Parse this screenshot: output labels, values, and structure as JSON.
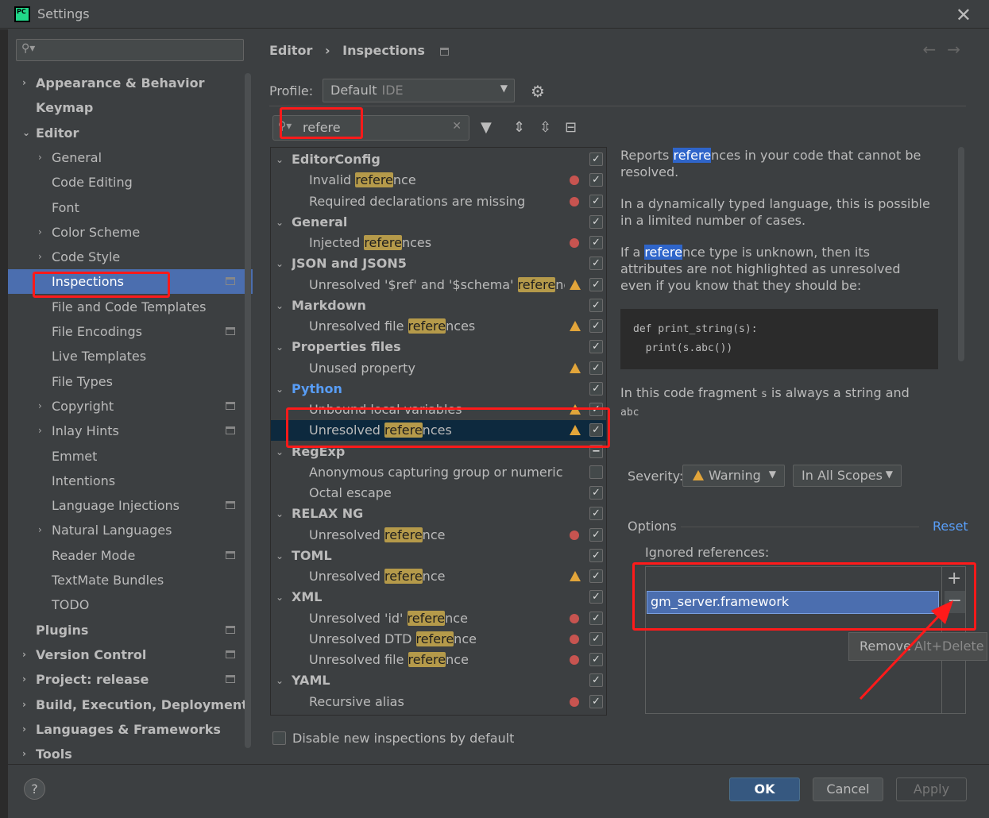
{
  "window": {
    "title": "Settings",
    "app_icon_text": "PC"
  },
  "sidebar": {
    "search_placeholder": "",
    "items": [
      {
        "label": "Appearance & Behavior",
        "bold": true,
        "chevron": "›",
        "indent": 0
      },
      {
        "label": "Keymap",
        "bold": true,
        "chevron": "",
        "indent": 0
      },
      {
        "label": "Editor",
        "bold": true,
        "chevron": "⌄",
        "indent": 0
      },
      {
        "label": "General",
        "chevron": "›",
        "indent": 1
      },
      {
        "label": "Code Editing",
        "chevron": "",
        "indent": 1
      },
      {
        "label": "Font",
        "chevron": "",
        "indent": 1
      },
      {
        "label": "Color Scheme",
        "chevron": "›",
        "indent": 1
      },
      {
        "label": "Code Style",
        "chevron": "›",
        "indent": 1
      },
      {
        "label": "Inspections",
        "chevron": "",
        "indent": 1,
        "selected": true,
        "proj": true
      },
      {
        "label": "File and Code Templates",
        "chevron": "",
        "indent": 1
      },
      {
        "label": "File Encodings",
        "chevron": "",
        "indent": 1,
        "proj": true
      },
      {
        "label": "Live Templates",
        "chevron": "",
        "indent": 1
      },
      {
        "label": "File Types",
        "chevron": "",
        "indent": 1
      },
      {
        "label": "Copyright",
        "chevron": "›",
        "indent": 1,
        "proj": true
      },
      {
        "label": "Inlay Hints",
        "chevron": "›",
        "indent": 1,
        "proj": true
      },
      {
        "label": "Emmet",
        "chevron": "",
        "indent": 1
      },
      {
        "label": "Intentions",
        "chevron": "",
        "indent": 1
      },
      {
        "label": "Language Injections",
        "chevron": "",
        "indent": 1,
        "proj": true
      },
      {
        "label": "Natural Languages",
        "chevron": "›",
        "indent": 1
      },
      {
        "label": "Reader Mode",
        "chevron": "",
        "indent": 1,
        "proj": true
      },
      {
        "label": "TextMate Bundles",
        "chevron": "",
        "indent": 1
      },
      {
        "label": "TODO",
        "chevron": "",
        "indent": 1
      },
      {
        "label": "Plugins",
        "bold": true,
        "chevron": "",
        "indent": 0,
        "proj": true
      },
      {
        "label": "Version Control",
        "bold": true,
        "chevron": "›",
        "indent": 0,
        "proj": true
      },
      {
        "label": "Project: release",
        "bold": true,
        "chevron": "›",
        "indent": 0,
        "proj": true
      },
      {
        "label": "Build, Execution, Deployment",
        "bold": true,
        "chevron": "›",
        "indent": 0
      },
      {
        "label": "Languages & Frameworks",
        "bold": true,
        "chevron": "›",
        "indent": 0
      },
      {
        "label": "Tools",
        "bold": true,
        "chevron": "›",
        "indent": 0
      }
    ]
  },
  "breadcrumb": {
    "parent": "Editor",
    "separator": "›",
    "current": "Inspections"
  },
  "profile": {
    "label": "Profile:",
    "value": "Default",
    "scope": "IDE"
  },
  "filter": {
    "value": "refere"
  },
  "tree": [
    {
      "type": "group",
      "label": "EditorConfig",
      "check": "on"
    },
    {
      "type": "item",
      "pre": "Invalid ",
      "hl": "refere",
      "post": "nce",
      "sev": "err",
      "check": "on"
    },
    {
      "type": "item",
      "pre": "Required declarations are missing",
      "hl": "",
      "post": "",
      "sev": "err",
      "check": "on"
    },
    {
      "type": "group",
      "label": "General",
      "check": "on"
    },
    {
      "type": "item",
      "pre": "Injected ",
      "hl": "refere",
      "post": "nces",
      "sev": "err",
      "check": "on"
    },
    {
      "type": "group",
      "label": "JSON and JSON5",
      "check": "on"
    },
    {
      "type": "item",
      "pre": "Unresolved '$ref' and '$schema' ",
      "hl": "refere",
      "post": "nces",
      "sev": "warn",
      "check": "on"
    },
    {
      "type": "group",
      "label": "Markdown",
      "check": "on"
    },
    {
      "type": "item",
      "pre": "Unresolved file ",
      "hl": "refere",
      "post": "nces",
      "sev": "warn",
      "check": "on"
    },
    {
      "type": "group",
      "label": "Properties files",
      "check": "on"
    },
    {
      "type": "item",
      "pre": "Unused property",
      "hl": "",
      "post": "",
      "sev": "warn",
      "check": "on"
    },
    {
      "type": "group",
      "label": "Python",
      "check": "on",
      "python": true
    },
    {
      "type": "item",
      "pre": "Unbound local variables",
      "hl": "",
      "post": "",
      "sev": "warn",
      "check": "on"
    },
    {
      "type": "item",
      "pre": "Unresolved ",
      "hl": "refere",
      "post": "nces",
      "sev": "warn",
      "check": "on",
      "selected": true
    },
    {
      "type": "group",
      "label": "RegExp",
      "check": "mixed"
    },
    {
      "type": "item",
      "pre": "Anonymous capturing group or numeric bac",
      "hl": "",
      "post": "",
      "sev": "",
      "check": "off"
    },
    {
      "type": "item",
      "pre": "Octal escape",
      "hl": "",
      "post": "",
      "sev": "",
      "check": "on"
    },
    {
      "type": "group",
      "label": "RELAX NG",
      "check": "on"
    },
    {
      "type": "item",
      "pre": "Unresolved ",
      "hl": "refere",
      "post": "nce",
      "sev": "err",
      "check": "on"
    },
    {
      "type": "group",
      "label": "TOML",
      "check": "on"
    },
    {
      "type": "item",
      "pre": "Unresolved ",
      "hl": "refere",
      "post": "nce",
      "sev": "warn",
      "check": "on"
    },
    {
      "type": "group",
      "label": "XML",
      "check": "on"
    },
    {
      "type": "item",
      "pre": "Unresolved 'id' ",
      "hl": "refere",
      "post": "nce",
      "sev": "err",
      "check": "on"
    },
    {
      "type": "item",
      "pre": "Unresolved DTD ",
      "hl": "refere",
      "post": "nce",
      "sev": "err",
      "check": "on"
    },
    {
      "type": "item",
      "pre": "Unresolved file ",
      "hl": "refere",
      "post": "nce",
      "sev": "err",
      "check": "on"
    },
    {
      "type": "group",
      "label": "YAML",
      "check": "on"
    },
    {
      "type": "item",
      "pre": "Recursive alias",
      "hl": "",
      "post": "",
      "sev": "err",
      "check": "on"
    }
  ],
  "description": {
    "p1_pre": "Reports ",
    "p1_hl": "refere",
    "p1_post": "nces in your code that cannot be resolved.",
    "p2": "In a dynamically typed language, this is possible in a limited number of cases.",
    "p3_pre": "If a ",
    "p3_hl": "refere",
    "p3_post": "nce type is unknown, then its attributes are not highlighted as unresolved even if you know that they should be:",
    "code_line1": "def print_string(s):",
    "code_line2": "  print(s.abc())",
    "p4_a": "In this code fragment ",
    "p4_code1": "s",
    "p4_b": " is always a string and ",
    "p4_code2": "abc"
  },
  "severity": {
    "label": "Severity:",
    "value": "Warning",
    "scope": "In All Scopes"
  },
  "options": {
    "label": "Options",
    "reset": "Reset",
    "ignored_label": "Ignored references:",
    "ignored_items": [
      "gm_server.framework"
    ]
  },
  "tooltip": {
    "text": "Remove",
    "shortcut": "Alt+Delete"
  },
  "disable_new": {
    "label": "Disable new inspections by default",
    "checked": false
  },
  "buttons": {
    "ok": "OK",
    "cancel": "Cancel",
    "apply": "Apply",
    "help": "?"
  },
  "colors": {
    "selection": "#4b6eaf",
    "annotation_red": "#ff1a1a",
    "python_group": "#589df6",
    "match_highlight": "#b59a4a",
    "error": "#c75450",
    "warning": "#e2a53a"
  }
}
